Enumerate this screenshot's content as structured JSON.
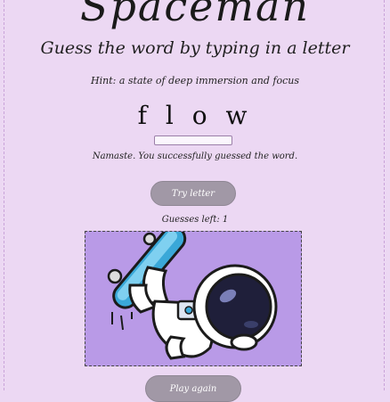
{
  "game": {
    "title": "Spaceman",
    "subtitle": "Guess the word by typing in a letter",
    "hint": "Hint: a state of deep immersion and focus",
    "word_display": "f l o w",
    "message": "Namaste. You successfully guessed the word.",
    "try_button": "Try letter",
    "guesses_left": "Guesses left: 1",
    "bottom_button": "Play again"
  },
  "colors": {
    "background": "#ecd8f3",
    "picture_bg": "#b99ae7",
    "button": "#a198a6"
  },
  "icons": {
    "illustration": "astronaut-on-skateboard"
  }
}
